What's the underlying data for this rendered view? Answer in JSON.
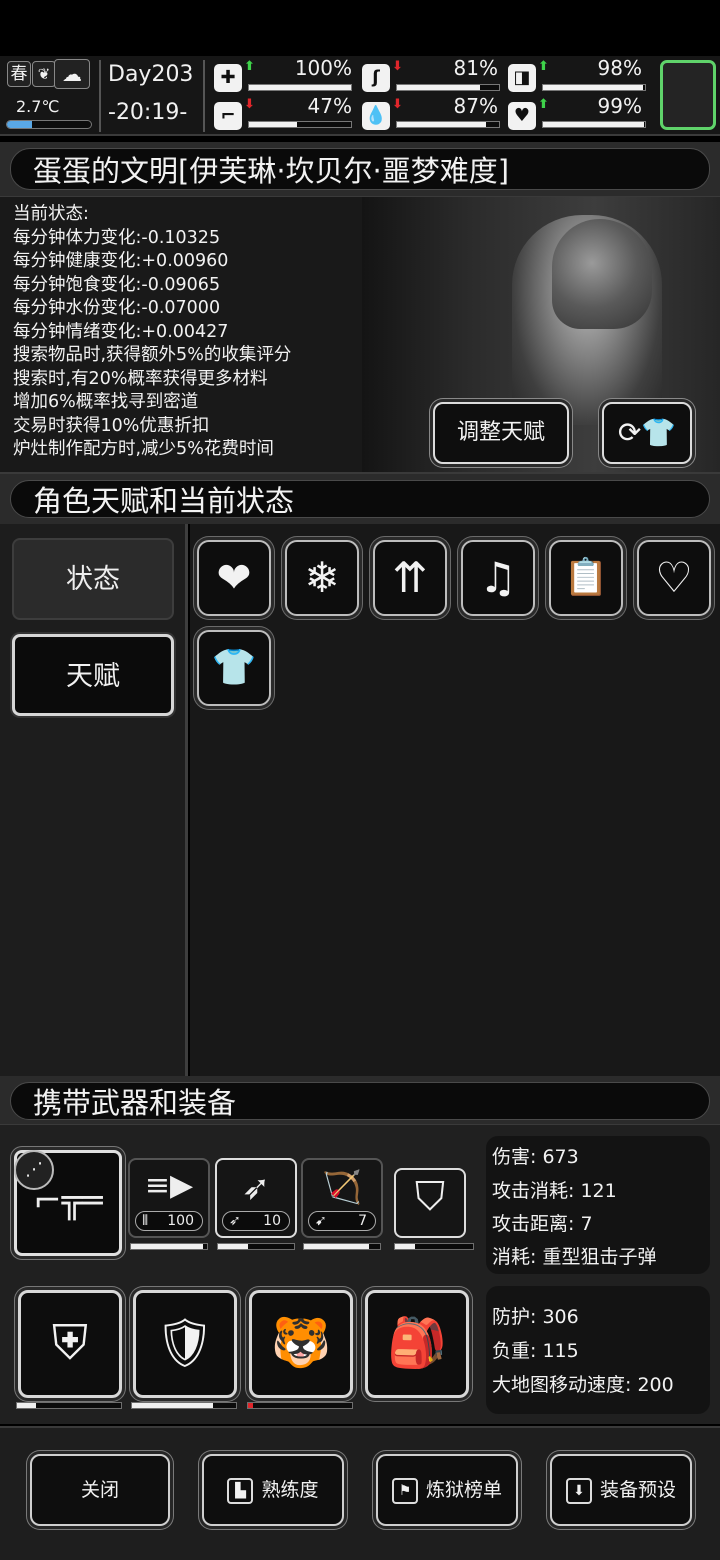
{
  "top": {
    "season": "春",
    "temperature": "2.7℃",
    "temperature_level": 0.3,
    "day": "Day203",
    "time": "-20:19-",
    "stats": [
      {
        "name": "stamina",
        "icon": "first-aid-icon",
        "glyph": "✚",
        "trend": "up",
        "value": "100%",
        "level": 1.0
      },
      {
        "name": "hunger",
        "icon": "stomach-icon",
        "glyph": "ʃ",
        "trend": "down",
        "value": "81%",
        "level": 0.81
      },
      {
        "name": "medicine",
        "icon": "pill-icon",
        "glyph": "◨",
        "trend": "up",
        "value": "98%",
        "level": 0.98
      },
      {
        "name": "leg",
        "icon": "boot-icon",
        "glyph": "⌐",
        "trend": "down",
        "value": "47%",
        "level": 0.47
      },
      {
        "name": "water",
        "icon": "water-drop-icon",
        "glyph": "💧",
        "trend": "down",
        "value": "87%",
        "level": 0.87
      },
      {
        "name": "mood",
        "icon": "heart-pulse-icon",
        "glyph": "♥",
        "trend": "up",
        "value": "99%",
        "level": 0.99
      }
    ]
  },
  "character": {
    "title": "蛋蛋的文明[伊芙琳·坎贝尔·噩梦难度]",
    "status_lines": [
      "当前状态:",
      "每分钟体力变化:-0.10325",
      "每分钟健康变化:+0.00960",
      "每分钟饱食变化:-0.09065",
      "每分钟水份变化:-0.07000",
      "每分钟情绪变化:+0.00427",
      "搜索物品时,获得额外5%的收集评分",
      "搜索时,有20%概率获得更多材料",
      "增加6%概率找寻到密道",
      "交易时获得10%优惠折扣",
      "炉灶制作配方时,减少5%花费时间"
    ],
    "adjust_button": "调整天赋"
  },
  "talents": {
    "header": "角色天赋和当前状态",
    "tabs": [
      "状态",
      "天赋"
    ],
    "icons": [
      {
        "icon": "heart-icon",
        "glyph": "❤"
      },
      {
        "icon": "snowflake-icon",
        "glyph": "❄"
      },
      {
        "icon": "stomach-arrows-icon",
        "glyph": "⇈"
      },
      {
        "icon": "music-heart-icon",
        "glyph": "♫"
      },
      {
        "icon": "clipboard-pill-icon",
        "glyph": "📋"
      },
      {
        "icon": "stomach-heart-icon",
        "glyph": "♡"
      },
      {
        "icon": "shirt-sparkle-icon",
        "glyph": "👕"
      }
    ]
  },
  "gear": {
    "header": "携带武器和装备",
    "weapons": [
      {
        "icon": "sniper-rifle-icon",
        "glyph": "⌐╦═",
        "ammo": ""
      },
      {
        "icon": "gatling-gun-icon",
        "glyph": "≡▶",
        "ammo": "100",
        "durability": 0.95
      },
      {
        "icon": "spear-icon",
        "glyph": "➶",
        "ammo": "10",
        "durability": 0.4
      },
      {
        "icon": "crossbow-icon",
        "glyph": "🏹",
        "ammo": "7",
        "durability": 0.85
      },
      {
        "icon": "riot-shield-icon",
        "glyph": "⛉",
        "ammo": "",
        "durability": 0.25
      }
    ],
    "weapon_info": [
      "伤害: 673",
      "攻击消耗: 121",
      "攻击距离: 7",
      "消耗: 重型狙击子弹"
    ],
    "armor": [
      {
        "icon": "knee-pads-icon",
        "glyph": "⛨",
        "durability": 0.18
      },
      {
        "icon": "body-armor-icon",
        "glyph": "🛡",
        "durability": 0.78
      },
      {
        "icon": "tiger-hat-icon",
        "glyph": "🐯",
        "durability": 0.05,
        "alert": true
      },
      {
        "icon": "backpack-icon",
        "glyph": "🎒",
        "durability": 0
      }
    ],
    "armor_info": [
      "防护: 306",
      "负重: 115",
      "大地图移动速度: 200"
    ]
  },
  "footer": {
    "buttons": [
      {
        "label": "关闭",
        "icon": ""
      },
      {
        "label": "熟练度",
        "icon": "podium-icon"
      },
      {
        "label": "炼狱榜单",
        "icon": "banner-icon"
      },
      {
        "label": "装备预设",
        "icon": "equipment-preset-icon"
      }
    ]
  },
  "colors": {
    "accent_green": "#5fd36a",
    "up_arrow": "#3ed34a",
    "down_arrow": "#e0262b",
    "temp_blue": "#5aa8e6"
  }
}
